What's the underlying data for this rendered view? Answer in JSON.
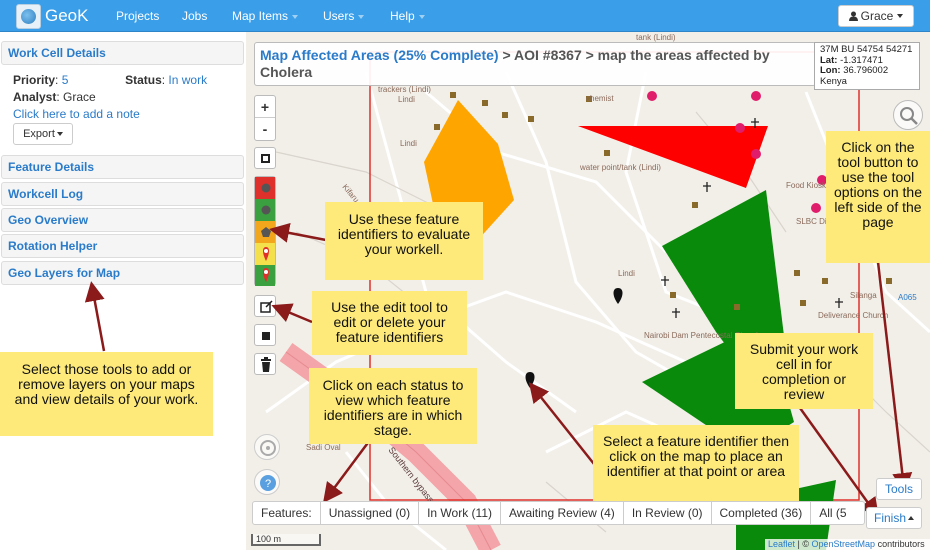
{
  "navbar": {
    "brand": "GeoK",
    "items": [
      "Projects",
      "Jobs",
      "Map Items",
      "Users",
      "Help"
    ],
    "user": "Grace"
  },
  "left_panel": {
    "work_cell_details": "Work Cell Details",
    "priority_label": "Priority",
    "priority_value": "5",
    "status_label": "Status",
    "status_value": "In work",
    "analyst_label": "Analyst",
    "analyst_value": "Grace",
    "add_note": "Click here to add a note",
    "export": "Export",
    "sections": [
      "Feature Details",
      "Workcell Log",
      "Geo Overview",
      "Rotation Helper",
      "Geo Layers for Map"
    ]
  },
  "map": {
    "title_link": "Map Affected Areas (25% Complete)",
    "title_rest": " > AOI #8367 > map the areas affected by Cholera",
    "coords": {
      "grid": "37M BU 54754 54271",
      "lat_label": "Lat:",
      "lat": "-1.317471",
      "lon_label": "Lon:",
      "lon": "36.796002",
      "country": "Kenya"
    },
    "zoom_in": "+",
    "zoom_out": "-",
    "labels": {
      "chemist": "chemist",
      "water_tank": "water point/tank (Lindi)",
      "lindi1": "Lindi",
      "lindi2": "Lindi",
      "lindi3": "Lindi",
      "tank_top": "tank (Lindi)",
      "trackers": "trackers (Lindi)",
      "kifaru": "Kifaru",
      "nairobi_dam": "Nairobi Dam Pentecostal Church",
      "deliverance": "Deliverance Church",
      "food_kiosk": "Food Kiosk",
      "slbc": "SLBC Dispensary",
      "silanga": "Silanga",
      "a065": "A065",
      "southern_bypass": "Southern bypass",
      "sadi_oval": "Sadi Oval"
    }
  },
  "notes": {
    "feature_ids": "Use these feature identifiers to evaluate your workell.",
    "edit_tool": "Use the edit tool to edit or delete your feature identifiers",
    "status": "Click on each status to view which feature identifiers are in which stage.",
    "select_feature": "Select a feature identifier then click on the map to place an identifier at that point or area",
    "submit": "Submit your work cell in for completion or review",
    "tools": "Click on the tool button to use the tool options on the left side of the page",
    "layers": "Select those tools to add or remove layers on your maps and view details of your work."
  },
  "status_bar": [
    "Features:",
    "Unassigned (0)",
    "In Work (11)",
    "Awaiting Review (4)",
    "In Review (0)",
    "Completed (36)",
    "All (5"
  ],
  "tools_button": "Tools",
  "finish_button": "Finish",
  "scale": "100 m",
  "attribution": {
    "leaflet": "Leaflet",
    "sep": " | © ",
    "osm": "OpenStreetMap",
    "rest": " contributors"
  },
  "colors": {
    "navbar": "#3a9ee8",
    "link": "#2a7bc9",
    "note": "#fdea7a",
    "arrow": "#8b1a1a",
    "red_feature": "#ff0000",
    "green_feature": "#0a8a0a",
    "orange_feature": "#ffa500"
  },
  "icons": [
    "globe-icon",
    "user-icon",
    "search-icon",
    "bounding-box-icon",
    "edit-icon",
    "square-icon",
    "trash-icon",
    "crosshair-icon",
    "help-icon",
    "map-marker-icon"
  ]
}
